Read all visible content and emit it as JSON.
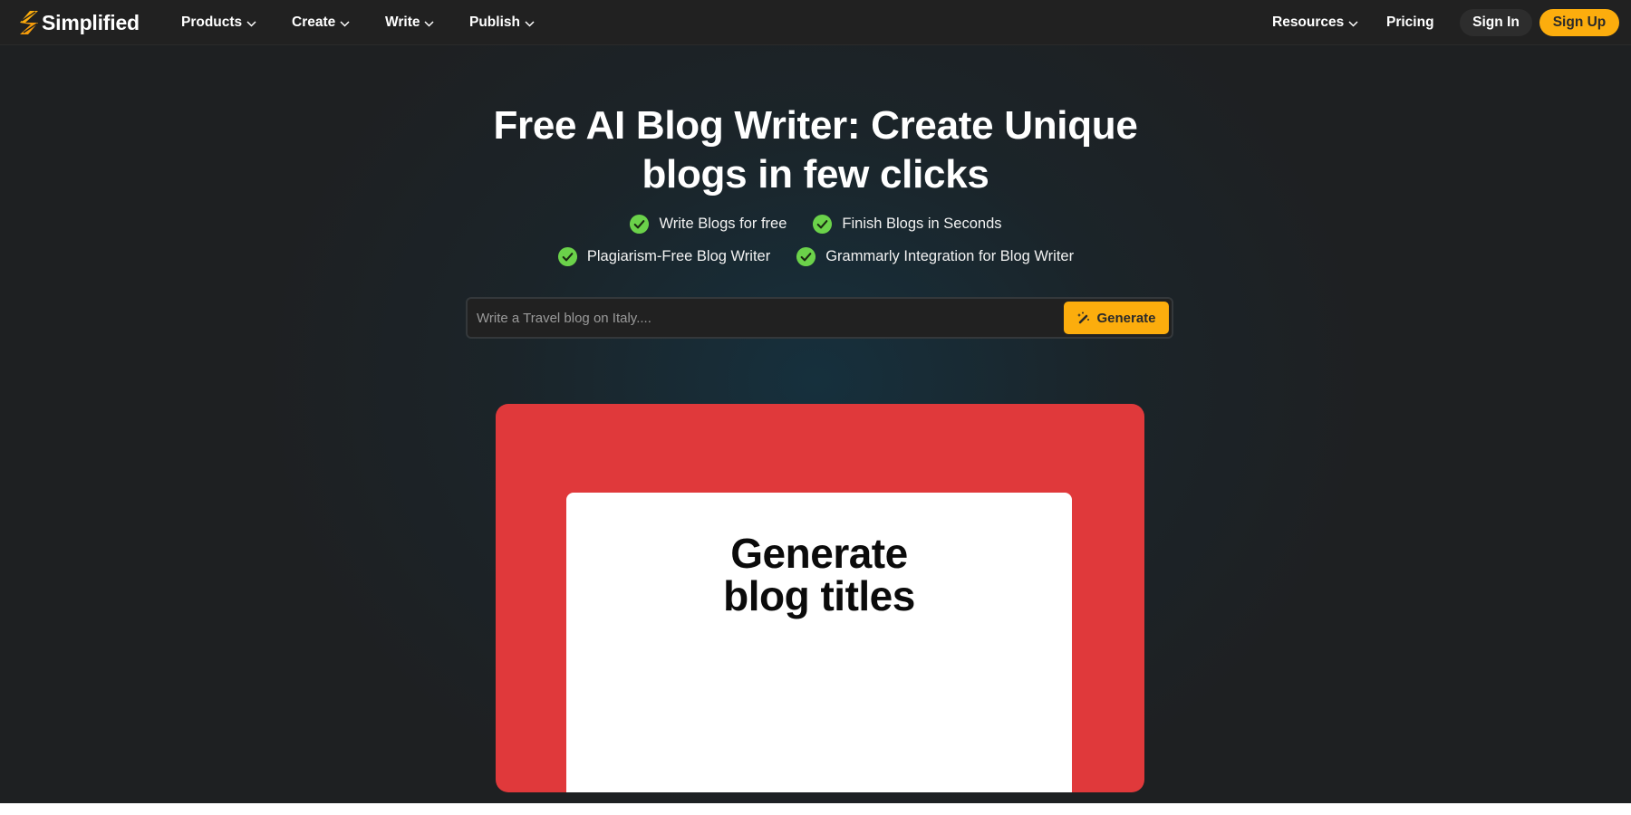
{
  "nav": {
    "brand": "Simplified",
    "brand_color": "#FCAD0D",
    "menu": [
      {
        "label": "Products",
        "has_dropdown": true
      },
      {
        "label": "Create",
        "has_dropdown": true
      },
      {
        "label": "Write",
        "has_dropdown": true
      },
      {
        "label": "Publish",
        "has_dropdown": true
      }
    ],
    "right_menu": [
      {
        "label": "Resources",
        "has_dropdown": true
      },
      {
        "label": "Pricing",
        "has_dropdown": false
      }
    ],
    "sign_in_label": "Sign In",
    "sign_up_label": "Sign Up"
  },
  "hero": {
    "title_line1": "Free AI Blog Writer: Create Unique",
    "title_line2": "blogs in few clicks",
    "features": [
      {
        "icon": "check-circle-icon",
        "label": "Write Blogs for free"
      },
      {
        "icon": "check-circle-icon",
        "label": "Finish Blogs in Seconds"
      },
      {
        "icon": "check-circle-icon",
        "label": "Plagiarism-Free Blog Writer"
      },
      {
        "icon": "check-circle-icon",
        "label": "Grammarly Integration for Blog Writer"
      }
    ],
    "check_color": "#6BD24A",
    "prompt": {
      "value": "",
      "placeholder": "Write a Travel blog on Italy....",
      "button_label": "Generate",
      "button_icon": "magic-wand-icon",
      "button_color": "#FCAD0D"
    }
  },
  "demo": {
    "title_line1": "Generate",
    "title_line2": "blog titles",
    "frame_color": "#E0393B"
  }
}
